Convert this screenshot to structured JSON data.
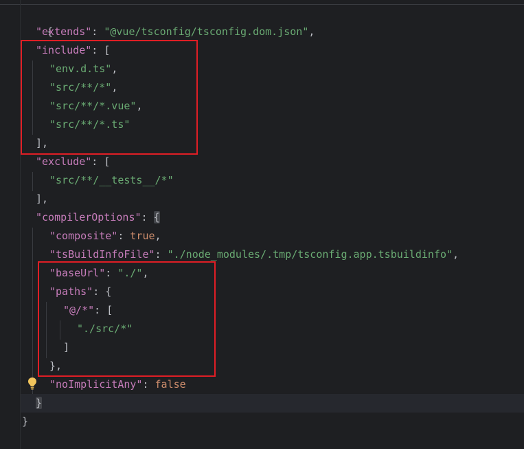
{
  "code": {
    "l1": "{",
    "l2": {
      "key": "\"extends\"",
      "sep": ": ",
      "val": "\"@vue/tsconfig/tsconfig.dom.json\"",
      "end": ","
    },
    "l3": {
      "key": "\"include\"",
      "sep": ": ",
      "open": "["
    },
    "l4": {
      "val": "\"env.d.ts\"",
      "end": ","
    },
    "l5": {
      "val": "\"src/**/*\"",
      "end": ","
    },
    "l6": {
      "val": "\"src/**/*.vue\"",
      "end": ","
    },
    "l7": {
      "val": "\"src/**/*.ts\""
    },
    "l8": "],",
    "l9": {
      "key": "\"exclude\"",
      "sep": ": ",
      "open": "["
    },
    "l10": {
      "val": "\"src/**/__tests__/*\""
    },
    "l11": "],",
    "l12": {
      "key": "\"compilerOptions\"",
      "sep": ": ",
      "open": "{"
    },
    "l13": {
      "key": "\"composite\"",
      "sep": ": ",
      "val": "true",
      "end": ","
    },
    "l14": {
      "key": "\"tsBuildInfoFile\"",
      "sep": ": ",
      "val": "\"./node_modules/.tmp/tsconfig.app.tsbuildinfo\"",
      "end": ","
    },
    "l15": {
      "key": "\"baseUrl\"",
      "sep": ": ",
      "val": "\"./\"",
      "end": ","
    },
    "l16": {
      "key": "\"paths\"",
      "sep": ": ",
      "open": "{"
    },
    "l17": {
      "key": "\"@/*\"",
      "sep": ": ",
      "open": "["
    },
    "l18": {
      "val": "\"./src/*\""
    },
    "l19": "]",
    "l20": "},",
    "l21": {
      "key": "\"noImplicitAny\"",
      "sep": ": ",
      "val": "false"
    },
    "l22": "}",
    "l23": "}"
  },
  "colors": {
    "background": "#1e1f22",
    "key": "#c77dbb",
    "string": "#6aab73",
    "keyword": "#cf8e6d",
    "highlight_box": "#e01e25"
  },
  "icons": {
    "intention_bulb": "lightbulb-icon"
  }
}
